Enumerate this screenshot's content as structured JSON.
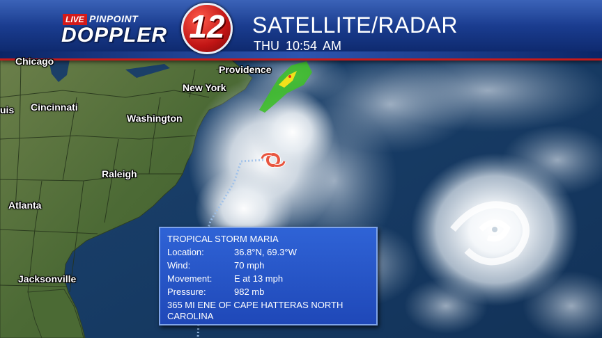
{
  "header": {
    "logo_live": "LIVE",
    "logo_pinpoint": "PINPOINT",
    "logo_doppler": "DOPPLER",
    "logo_number": "12",
    "title": "SATELLITE/RADAR",
    "time": "THU  10:54 AM"
  },
  "cities": {
    "chicago": "Chicago",
    "providence": "Providence",
    "new_york": "New York",
    "cincinnati": "Cincinnati",
    "washington": "Washington",
    "raleigh": "Raleigh",
    "atlanta": "Atlanta",
    "jacksonville": "Jacksonville",
    "partial_west": "uis"
  },
  "storm": {
    "name": "TROPICAL STORM MARIA",
    "location_label": "Location:",
    "location_value": "36.8°N, 69.3°W",
    "wind_label": "Wind:",
    "wind_value": "70 mph",
    "movement_label": "Movement:",
    "movement_value": "E at 13 mph",
    "pressure_label": "Pressure:",
    "pressure_value": "982 mb",
    "distance_line1": "365 MI ENE OF CAPE HATTERAS NORTH",
    "distance_line2": "CAROLINA"
  },
  "colors": {
    "header_blue": "#1a3c8f",
    "logo_red": "#c01414",
    "info_box_blue": "#2458c6",
    "storm_symbol": "#e8553f",
    "radar_green": "#3fbf2a",
    "ocean": "#173a63",
    "land": "#4f6b3a"
  },
  "icons": {
    "storm_symbol": "tropical-storm-icon"
  }
}
